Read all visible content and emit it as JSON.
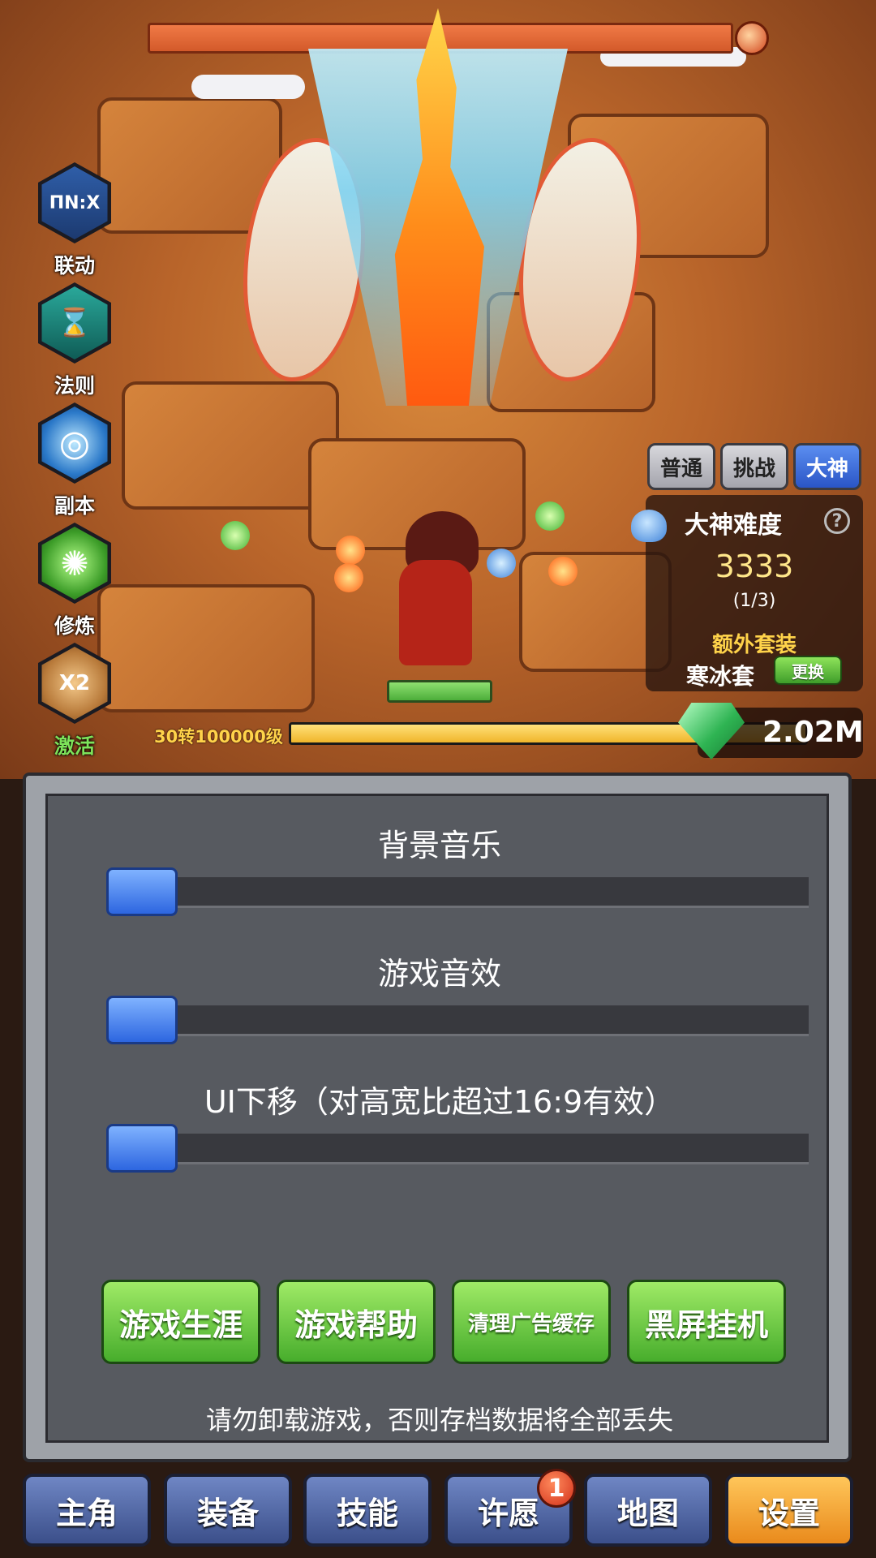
{
  "left_menu": [
    {
      "label": "联动",
      "icon": "link-event-icon",
      "icon_text": "ΠN:X"
    },
    {
      "label": "法则",
      "icon": "hourglass-icon",
      "icon_text": "⌛"
    },
    {
      "label": "副本",
      "icon": "vortex-icon",
      "icon_text": "◎"
    },
    {
      "label": "修炼",
      "icon": "training-swirl-icon",
      "icon_text": "✺"
    },
    {
      "label": "激活",
      "icon": "gourd-x2-icon",
      "icon_text": "X2"
    }
  ],
  "difficulty": {
    "tabs": [
      "普通",
      "挑战",
      "大神"
    ],
    "active_tab": "大神",
    "title": "大神难度",
    "help": "?",
    "value": "3333",
    "progress": "(1/3)",
    "extra_set_title": "额外套装",
    "set_name": "寒冰套",
    "swap_label": "更换"
  },
  "player": {
    "level_text": "30转100000级",
    "xp_fraction": 1.0,
    "gems": "2.02M"
  },
  "settings": {
    "sliders": [
      {
        "label": "背景音乐",
        "value": 0
      },
      {
        "label": "游戏音效",
        "value": 0
      },
      {
        "label": "UI下移（对高宽比超过16:9有效）",
        "value": 0
      }
    ],
    "buttons": [
      "游戏生涯",
      "游戏帮助",
      "清理广告缓存",
      "黑屏挂机"
    ],
    "warning": "请勿卸载游戏，否则存档数据将全部丢失"
  },
  "bottom_nav": {
    "items": [
      "主角",
      "装备",
      "技能",
      "许愿",
      "地图",
      "设置"
    ],
    "active": "设置",
    "badge": "1"
  },
  "colors": {
    "accent_blue": "#2d66e0",
    "button_green": "#47ad2c",
    "nav_active": "#e98a1c",
    "gold_text": "#ffd34a"
  }
}
